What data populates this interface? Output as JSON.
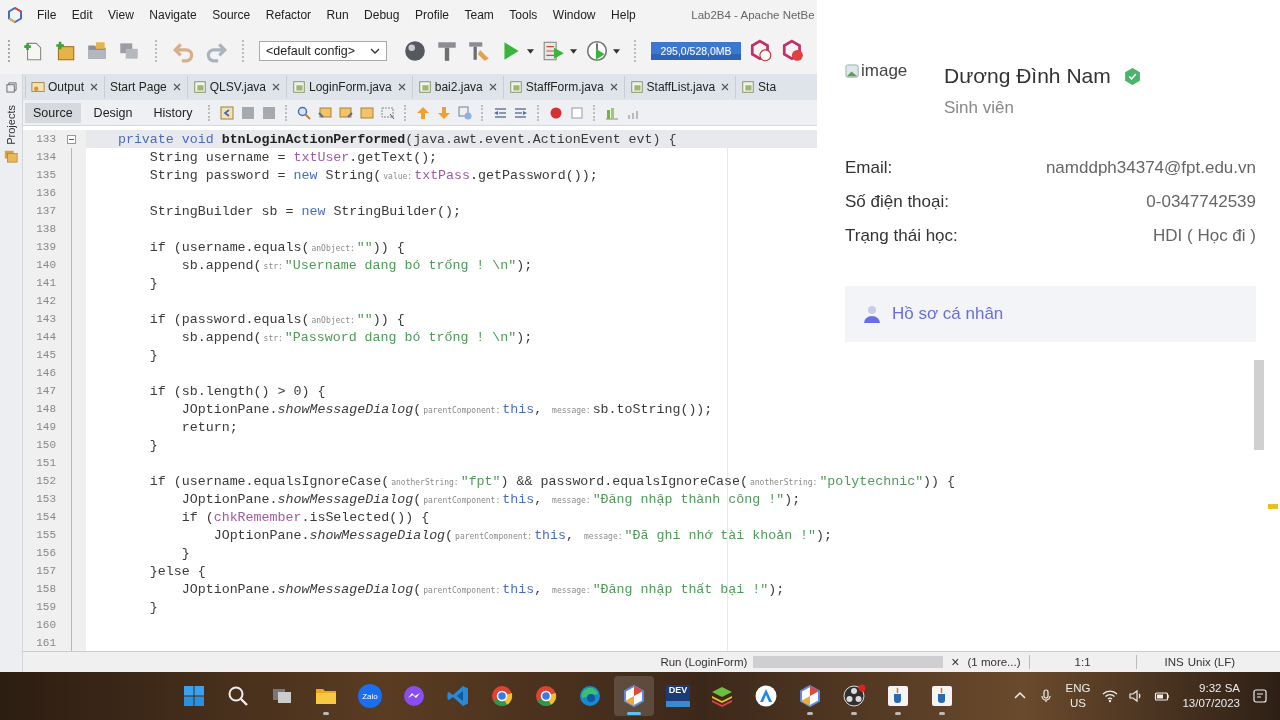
{
  "menu_bar": {
    "items": [
      "File",
      "Edit",
      "View",
      "Navigate",
      "Source",
      "Refactor",
      "Run",
      "Debug",
      "Profile",
      "Team",
      "Tools",
      "Window",
      "Help"
    ],
    "title": "Lab2B4 - Apache NetBe"
  },
  "toolbar": {
    "config": "<default config>",
    "memory": "295,0/528,0MB"
  },
  "side_strip": {
    "label": "Projects"
  },
  "doc_tabs": [
    {
      "label": "Output",
      "kind": "output",
      "cut": false
    },
    {
      "label": "Start Page",
      "kind": "page",
      "cut": false
    },
    {
      "label": "QLSV.java",
      "kind": "java",
      "cut": false
    },
    {
      "label": "LoginForm.java",
      "kind": "java",
      "cut": false
    },
    {
      "label": "bai2.java",
      "kind": "java",
      "cut": false
    },
    {
      "label": "StaffForm.java",
      "kind": "java",
      "cut": false
    },
    {
      "label": "StaffList.java",
      "kind": "java",
      "cut": false
    },
    {
      "label": "Sta",
      "kind": "java",
      "cut": true
    }
  ],
  "editor_tabs": [
    {
      "label": "Source",
      "selected": true
    },
    {
      "label": "Design",
      "selected": false
    },
    {
      "label": "History",
      "selected": false
    }
  ],
  "code_lines": [
    {
      "number": "133",
      "current": true,
      "fold": true,
      "tokens": [
        {
          "kind": "kw",
          "text": "    private void "
        },
        {
          "kind": "bold",
          "text": "btnLoginActionPerformed"
        },
        {
          "kind": "plain",
          "text": "(java.awt.event.ActionEvent evt) {"
        }
      ]
    },
    {
      "number": "134",
      "current": false,
      "fold": false,
      "tokens": [
        {
          "kind": "plain",
          "text": "        String username = "
        },
        {
          "kind": "field",
          "text": "txtUser"
        },
        {
          "kind": "plain",
          "text": ".getText();"
        }
      ]
    },
    {
      "number": "135",
      "current": false,
      "fold": false,
      "tokens": [
        {
          "kind": "plain",
          "text": "        String password = "
        },
        {
          "kind": "kw",
          "text": "new"
        },
        {
          "kind": "plain",
          "text": " String("
        },
        {
          "kind": "hint",
          "text": "value:"
        },
        {
          "kind": "field",
          "text": "txtPass"
        },
        {
          "kind": "plain",
          "text": ".getPassword());"
        }
      ]
    },
    {
      "number": "136",
      "current": false,
      "fold": false
    },
    {
      "number": "137",
      "current": false,
      "fold": false,
      "tokens": [
        {
          "kind": "plain",
          "text": "        StringBuilder sb = "
        },
        {
          "kind": "kw",
          "text": "new"
        },
        {
          "kind": "plain",
          "text": " StringBuilder();"
        }
      ]
    },
    {
      "number": "138",
      "current": false,
      "fold": false
    },
    {
      "number": "139",
      "current": false,
      "fold": false,
      "tokens": [
        {
          "kind": "plain",
          "text": "        if (username.equals("
        },
        {
          "kind": "hint",
          "text": "anObject:"
        },
        {
          "kind": "str",
          "text": "\"\""
        },
        {
          "kind": "plain",
          "text": ")) {"
        }
      ]
    },
    {
      "number": "140",
      "current": false,
      "fold": false,
      "tokens": [
        {
          "kind": "plain",
          "text": "            sb.append("
        },
        {
          "kind": "hint",
          "text": "str:"
        },
        {
          "kind": "str",
          "text": "\"Username dang bó trống ! \\n\""
        },
        {
          "kind": "plain",
          "text": ");"
        }
      ]
    },
    {
      "number": "141",
      "current": false,
      "fold": false,
      "tokens": [
        {
          "kind": "plain",
          "text": "        }"
        }
      ]
    },
    {
      "number": "142",
      "current": false,
      "fold": false
    },
    {
      "number": "143",
      "current": false,
      "fold": false,
      "tokens": [
        {
          "kind": "plain",
          "text": "        if (password.equals("
        },
        {
          "kind": "hint",
          "text": "anObject:"
        },
        {
          "kind": "str",
          "text": "\"\""
        },
        {
          "kind": "plain",
          "text": ")) {"
        }
      ]
    },
    {
      "number": "144",
      "current": false,
      "fold": false,
      "tokens": [
        {
          "kind": "plain",
          "text": "            sb.append("
        },
        {
          "kind": "hint",
          "text": "str:"
        },
        {
          "kind": "str",
          "text": "\"Password dang bó trống ! \\n\""
        },
        {
          "kind": "plain",
          "text": ");"
        }
      ]
    },
    {
      "number": "145",
      "current": false,
      "fold": false,
      "tokens": [
        {
          "kind": "plain",
          "text": "        }"
        }
      ]
    },
    {
      "number": "146",
      "current": false,
      "fold": false
    },
    {
      "number": "147",
      "current": false,
      "fold": false,
      "tokens": [
        {
          "kind": "plain",
          "text": "        if (sb.length() > 0) {"
        }
      ]
    },
    {
      "number": "148",
      "current": false,
      "fold": false,
      "tokens": [
        {
          "kind": "plain",
          "text": "            JOptionPane."
        },
        {
          "kind": "italic",
          "text": "showMessageDialog"
        },
        {
          "kind": "plain",
          "text": "("
        },
        {
          "kind": "hint",
          "text": "parentComponent:"
        },
        {
          "kind": "kw",
          "text": "this"
        },
        {
          "kind": "plain",
          "text": ", "
        },
        {
          "kind": "hint",
          "text": "message:"
        },
        {
          "kind": "plain",
          "text": "sb.toString());"
        }
      ]
    },
    {
      "number": "149",
      "current": false,
      "fold": false,
      "tokens": [
        {
          "kind": "plain",
          "text": "            return;"
        }
      ]
    },
    {
      "number": "150",
      "current": false,
      "fold": false,
      "tokens": [
        {
          "kind": "plain",
          "text": "        }"
        }
      ]
    },
    {
      "number": "151",
      "current": false,
      "fold": false
    },
    {
      "number": "152",
      "current": false,
      "fold": false,
      "tokens": [
        {
          "kind": "plain",
          "text": "        if (username.equalsIgnoreCase("
        },
        {
          "kind": "hint",
          "text": "anotherString:"
        },
        {
          "kind": "str",
          "text": "\"fpt\""
        },
        {
          "kind": "plain",
          "text": ") && password.equalsIgnoreCase("
        },
        {
          "kind": "hint",
          "text": "anotherString:"
        },
        {
          "kind": "str",
          "text": "\"polytechnic\""
        },
        {
          "kind": "plain",
          "text": ")) {"
        }
      ]
    },
    {
      "number": "153",
      "current": false,
      "fold": false,
      "tokens": [
        {
          "kind": "plain",
          "text": "            JOptionPane."
        },
        {
          "kind": "italic",
          "text": "showMessageDialog"
        },
        {
          "kind": "plain",
          "text": "("
        },
        {
          "kind": "hint",
          "text": "parentComponent:"
        },
        {
          "kind": "kw",
          "text": "this"
        },
        {
          "kind": "plain",
          "text": ", "
        },
        {
          "kind": "hint",
          "text": "message:"
        },
        {
          "kind": "str",
          "text": "\"Đăng nhập thành công !\""
        },
        {
          "kind": "plain",
          "text": ");"
        }
      ]
    },
    {
      "number": "154",
      "current": false,
      "fold": false,
      "tokens": [
        {
          "kind": "plain",
          "text": "            if ("
        },
        {
          "kind": "field",
          "text": "chkRemember"
        },
        {
          "kind": "plain",
          "text": ".isSelected()) {"
        }
      ]
    },
    {
      "number": "155",
      "current": false,
      "fold": false,
      "tokens": [
        {
          "kind": "plain",
          "text": "                JOptionPane."
        },
        {
          "kind": "italic",
          "text": "showMessageDialog"
        },
        {
          "kind": "plain",
          "text": "("
        },
        {
          "kind": "hint",
          "text": "parentComponent:"
        },
        {
          "kind": "kw",
          "text": "this"
        },
        {
          "kind": "plain",
          "text": ", "
        },
        {
          "kind": "hint",
          "text": "message:"
        },
        {
          "kind": "str",
          "text": "\"Đã ghi nhớ tài khoản !\""
        },
        {
          "kind": "plain",
          "text": ");"
        }
      ]
    },
    {
      "number": "156",
      "current": false,
      "fold": false,
      "tokens": [
        {
          "kind": "plain",
          "text": "            }"
        }
      ]
    },
    {
      "number": "157",
      "current": false,
      "fold": false,
      "tokens": [
        {
          "kind": "plain",
          "text": "        }else {"
        }
      ]
    },
    {
      "number": "158",
      "current": false,
      "fold": false,
      "tokens": [
        {
          "kind": "plain",
          "text": "            JOptionPane."
        },
        {
          "kind": "italic",
          "text": "showMessageDialog"
        },
        {
          "kind": "plain",
          "text": "("
        },
        {
          "kind": "hint",
          "text": "parentComponent:"
        },
        {
          "kind": "kw",
          "text": "this"
        },
        {
          "kind": "plain",
          "text": ", "
        },
        {
          "kind": "hint",
          "text": "message:"
        },
        {
          "kind": "str",
          "text": "\"Đăng nhập thất bại !\""
        },
        {
          "kind": "plain",
          "text": ");"
        }
      ]
    },
    {
      "number": "159",
      "current": false,
      "fold": false,
      "tokens": [
        {
          "kind": "plain",
          "text": "        }"
        }
      ]
    },
    {
      "number": "160",
      "current": false,
      "fold": false
    },
    {
      "number": "161",
      "current": false,
      "fold": false
    }
  ],
  "status_bar": {
    "task": "Run (LoginForm)",
    "level": 1,
    "close": "×",
    "more": "(1 more...)",
    "position": "1:1",
    "mode": "INS",
    "line_ending": "Unix (LF)"
  },
  "profile": {
    "image_alt": "image",
    "name": "Dương Đình Nam",
    "verified": true,
    "role": "Sinh viên",
    "fields": [
      {
        "label": "Email:",
        "value": "namddph34374@fpt.edu.vn"
      },
      {
        "label": "Số điện thoại:",
        "value": "0-0347742539"
      },
      {
        "label": "Trạng thái học:",
        "value": "HDI ( Học đi )"
      }
    ],
    "menu": [
      {
        "label": "Hồ sơ cá nhân"
      }
    ]
  },
  "taskbar": {
    "apps": [
      {
        "kind": "start",
        "running": false,
        "active": false
      },
      {
        "kind": "search",
        "running": false,
        "active": false
      },
      {
        "kind": "taskview",
        "running": false,
        "active": false
      },
      {
        "kind": "explorer",
        "running": true,
        "active": false
      },
      {
        "kind": "zalo",
        "label": "Zalo",
        "running": false,
        "active": false
      },
      {
        "kind": "messenger",
        "running": false,
        "active": false
      },
      {
        "kind": "vscode",
        "running": false,
        "active": false
      },
      {
        "kind": "chrome",
        "running": false,
        "active": false
      },
      {
        "kind": "chrome",
        "running": false,
        "active": false
      },
      {
        "kind": "edge",
        "running": false,
        "active": false
      },
      {
        "kind": "netbeans",
        "running": true,
        "active": true
      },
      {
        "kind": "devcpp",
        "label": "DEV",
        "running": false,
        "active": false
      },
      {
        "kind": "bluestacks",
        "running": false,
        "active": false
      },
      {
        "kind": "store",
        "running": false,
        "active": false
      },
      {
        "kind": "netbeans",
        "running": true,
        "active": false
      },
      {
        "kind": "obs",
        "running": true,
        "active": false
      },
      {
        "kind": "java",
        "running": true,
        "active": false
      },
      {
        "kind": "java",
        "running": true,
        "active": false
      }
    ],
    "language": "ENG",
    "region": "US",
    "time": "9:32 SA",
    "date": "13/07/2023"
  }
}
